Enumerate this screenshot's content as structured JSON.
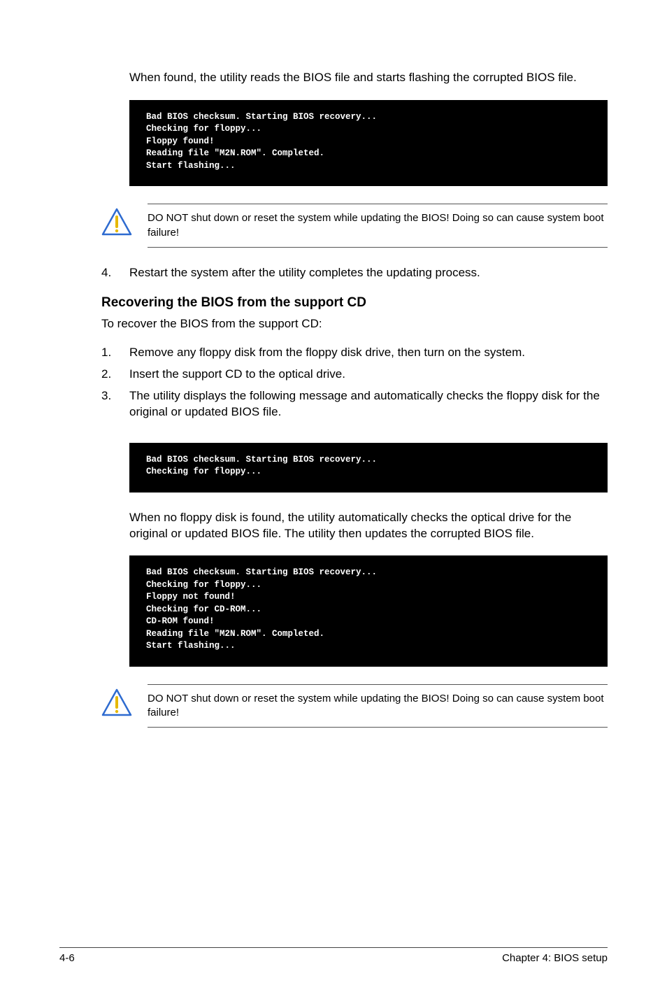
{
  "intro": "When found, the utility reads the BIOS file and starts flashing the corrupted BIOS file.",
  "terminal1": "Bad BIOS checksum. Starting BIOS recovery...\nChecking for floppy...\nFloppy found!\nReading file \"M2N.ROM\". Completed.\nStart flashing...",
  "warning1": "DO NOT shut down or reset the system while updating the BIOS! Doing so can cause system boot failure!",
  "step4": {
    "num": "4.",
    "text": "Restart the system after the utility completes the updating process."
  },
  "section_title": "Recovering the BIOS from the support CD",
  "section_sub": "To recover the BIOS from the support CD:",
  "steps": [
    {
      "num": "1.",
      "text": "Remove any floppy disk from the floppy disk drive, then turn on the system."
    },
    {
      "num": "2.",
      "text": "Insert the support CD to the optical drive."
    },
    {
      "num": "3.",
      "text": "The utility displays the following message and automatically checks the floppy disk for the original or updated BIOS file."
    }
  ],
  "terminal2": "Bad BIOS checksum. Starting BIOS recovery...\nChecking for floppy...",
  "after_t2": "When no floppy disk is found, the utility automatically checks the optical drive for the original or updated BIOS file. The utility then updates the corrupted BIOS file.",
  "terminal3": "Bad BIOS checksum. Starting BIOS recovery...\nChecking for floppy...\nFloppy not found!\nChecking for CD-ROM...\nCD-ROM found!\nReading file \"M2N.ROM\". Completed.\nStart flashing...",
  "warning2": "DO NOT shut down or reset the system while updating the BIOS! Doing so can cause system boot failure!",
  "footer_left": "4-6",
  "footer_right": "Chapter 4: BIOS setup"
}
